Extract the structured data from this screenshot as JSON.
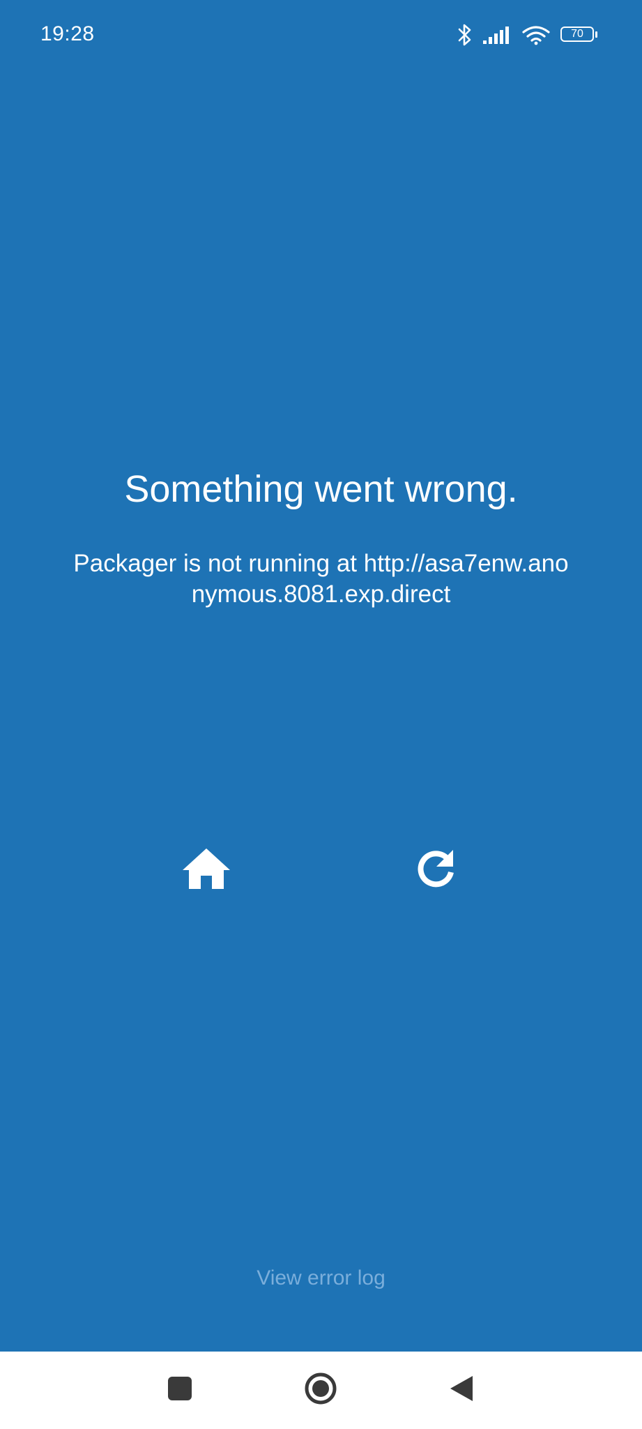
{
  "status_bar": {
    "time": "19:28",
    "icons": [
      "bluetooth-icon",
      "signal-icon",
      "wifi-icon",
      "battery-icon"
    ],
    "battery_level": "70"
  },
  "error": {
    "title": "Something went wrong.",
    "message": "Packager is not running at http://asa7enw.anonymous.8081.exp.direct"
  },
  "actions": {
    "home_icon": "home-icon",
    "reload_icon": "reload-icon",
    "view_error_log_label": "View error log"
  },
  "navigation_bar": {
    "buttons": [
      "recents-button",
      "home-button",
      "back-button"
    ]
  },
  "colors": {
    "background": "#1e73b5",
    "text": "#ffffff",
    "link": "#7aaedb",
    "nav_bar": "#ffffff",
    "nav_icon": "#3a3a3a"
  }
}
